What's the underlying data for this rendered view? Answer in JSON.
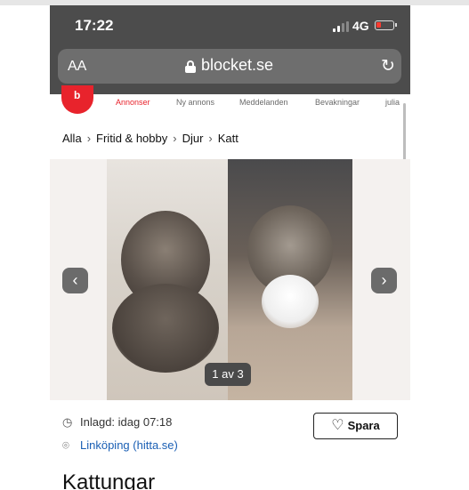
{
  "status": {
    "time": "17:22",
    "network": "4G"
  },
  "browser": {
    "text_size_label": "AA",
    "domain": "blocket.se",
    "reload_icon": "reload-icon",
    "lock_icon": "lock-icon"
  },
  "nav": {
    "items": [
      "Annonser",
      "Ny annons",
      "Meddelanden",
      "Bevakningar",
      "julia"
    ],
    "active": "Annonser"
  },
  "breadcrumb": [
    "Alla",
    "Fritid & hobby",
    "Djur",
    "Katt"
  ],
  "gallery": {
    "counter": "1 av 3",
    "prev_icon": "chevron-left-icon",
    "next_icon": "chevron-right-icon"
  },
  "listing": {
    "posted": "Inlagd: idag 07:18",
    "location": "Linköping (hitta.se)",
    "save_label": "Spara",
    "title": "Kattungar"
  },
  "colors": {
    "brand": "#e8232c",
    "link": "#1a5fb4",
    "status_bar": "#4c4c4c"
  }
}
